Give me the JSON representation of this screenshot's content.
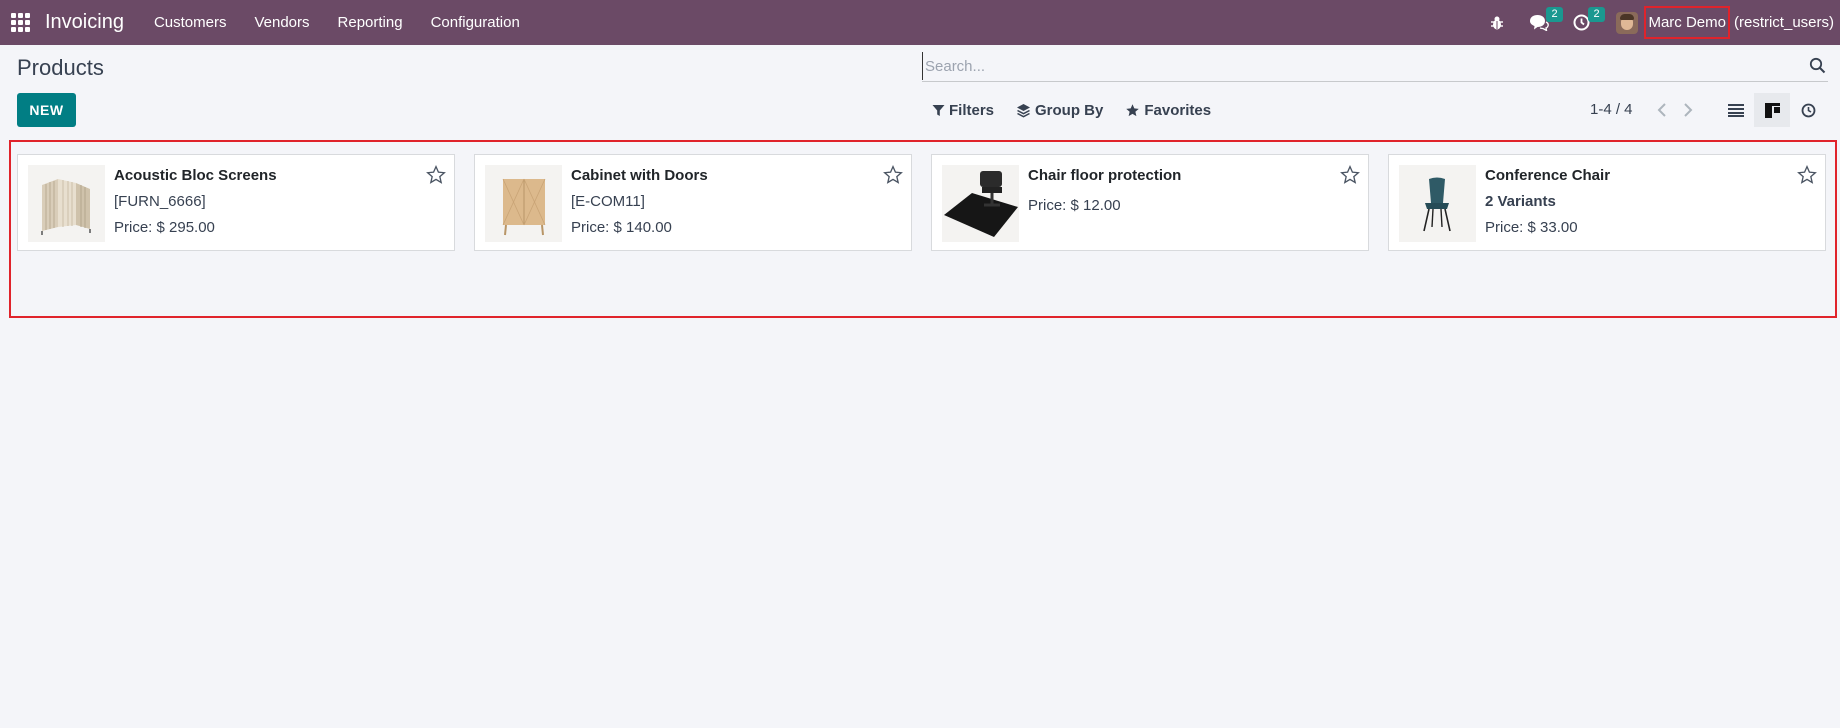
{
  "navbar": {
    "brand": "Invoicing",
    "menu": [
      "Customers",
      "Vendors",
      "Reporting",
      "Configuration"
    ],
    "messages_count": "2",
    "activities_count": "2",
    "user_name": "Marc Demo",
    "user_db": "(restrict_users)"
  },
  "control_panel": {
    "title": "Products",
    "new_label": "NEW",
    "search_placeholder": "Search...",
    "filters_label": "Filters",
    "group_by_label": "Group By",
    "favorites_label": "Favorites",
    "pager_value": "1-4 / 4"
  },
  "products": [
    {
      "name": "Acoustic Bloc Screens",
      "line1": "[FURN_6666]",
      "price": "Price: $ 295.00",
      "image": "acoustic-screen"
    },
    {
      "name": "Cabinet with Doors",
      "line1": "[E-COM11]",
      "price": "Price: $ 140.00",
      "image": "cabinet"
    },
    {
      "name": "Chair floor protection",
      "line1": "",
      "price": "Price: $ 12.00",
      "image": "floor-mat"
    },
    {
      "name": "Conference Chair",
      "line1": "2 Variants",
      "price": "Price: $ 33.00",
      "image": "chair"
    }
  ],
  "colors": {
    "navbar": "#6b4a66",
    "primary": "#017e84",
    "badge": "#1a9890",
    "highlight": "#e0232b"
  }
}
